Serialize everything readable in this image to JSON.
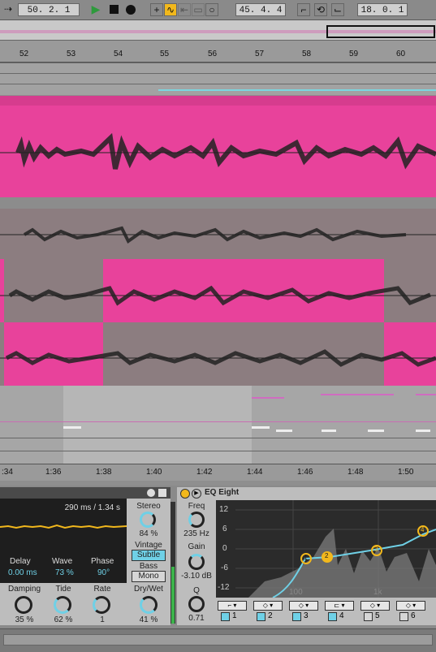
{
  "transport": {
    "position": "50.  2.  1",
    "loop_start": "45.  4.  4",
    "loop_length": "18.  0.  1"
  },
  "ruler_bars": [
    "52",
    "53",
    "54",
    "55",
    "56",
    "57",
    "58",
    "59",
    "60"
  ],
  "time_ticks": [
    ":34",
    "1:36",
    "1:38",
    "1:40",
    "1:42",
    "1:44",
    "1:46",
    "1:48",
    "1:50"
  ],
  "delay_device": {
    "time_readout": "290 ms / 1.34 s",
    "params": [
      {
        "label": "Delay",
        "value": "0.00 ms"
      },
      {
        "label": "Wave",
        "value": "73 %"
      },
      {
        "label": "Phase",
        "value": "90°"
      }
    ],
    "knobs": [
      {
        "label": "Damping",
        "value": "35 %"
      },
      {
        "label": "Tide",
        "value": "62 %"
      },
      {
        "label": "Rate",
        "value": "1"
      }
    ],
    "stereo": {
      "label": "Stereo",
      "value": "84 %"
    },
    "vintage": {
      "label": "Vintage",
      "value": "Subtle"
    },
    "bass": {
      "label": "Bass",
      "value": "Mono"
    },
    "drywet": {
      "label": "Dry/Wet",
      "value": "41 %"
    }
  },
  "eq_device": {
    "title": "EQ Eight",
    "freq": {
      "label": "Freq",
      "value": "235 Hz"
    },
    "gain": {
      "label": "Gain",
      "value": "-3.10 dB"
    },
    "q": {
      "label": "Q",
      "value": "0.71"
    },
    "y_ticks": [
      "12",
      "6",
      "0",
      "-6",
      "-12"
    ],
    "x_ticks": [
      "100",
      "1k"
    ],
    "bands": [
      "1",
      "2",
      "3",
      "4",
      "5",
      "6"
    ],
    "nodes": [
      "1",
      "2",
      "3",
      "4"
    ]
  },
  "colors": {
    "clip": "#e8429b",
    "muted_clip": "#8c7d80",
    "accent": "#f2b81c",
    "eq_curve": "#6fd0e6"
  }
}
